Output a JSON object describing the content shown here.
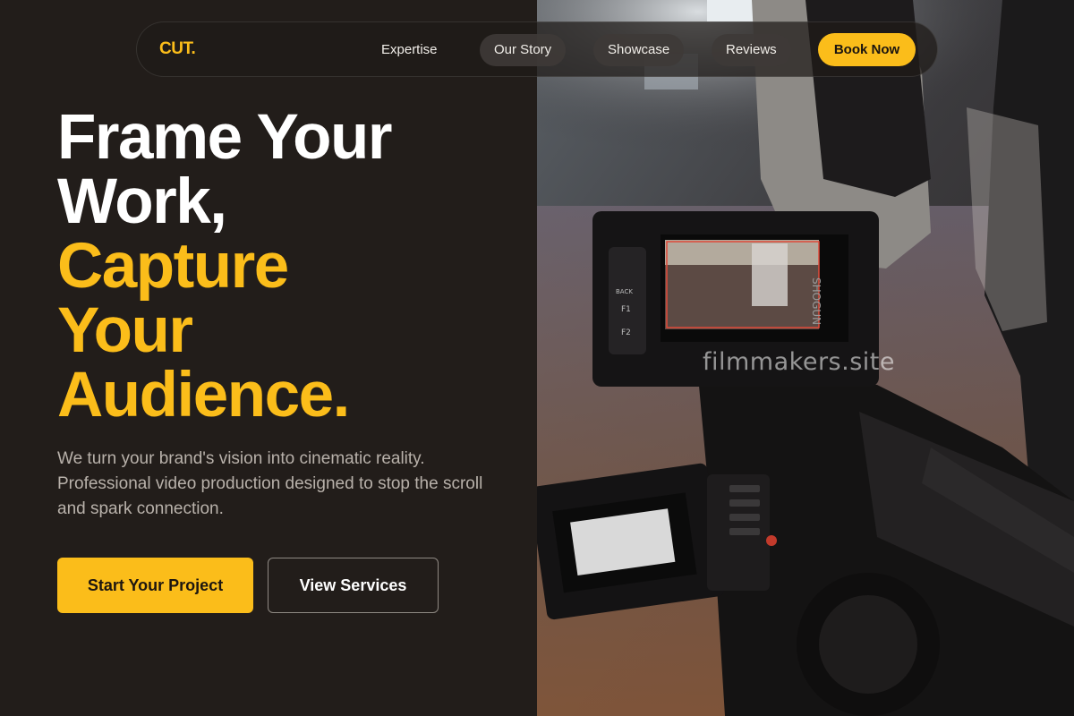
{
  "brand": {
    "logo": "CUT.",
    "accent_color": "#fbbd1a",
    "background_color": "#221d1a"
  },
  "nav": {
    "links": [
      {
        "label": "Expertise"
      },
      {
        "label": "Our Story"
      },
      {
        "label": "Showcase"
      },
      {
        "label": "Reviews"
      }
    ],
    "cta_label": "Book Now"
  },
  "hero": {
    "headline_lines_white": [
      "Frame Your",
      "Work,"
    ],
    "headline_lines_accent": [
      "Capture",
      "Your",
      "Audience."
    ],
    "subtext": "We turn your brand's vision into cinematic reality. Professional video production designed to stop the scroll and spark connection.",
    "primary_button": "Start Your Project",
    "secondary_button": "View Services"
  },
  "photo": {
    "description_icon": "cinema-camera-photo",
    "watermark": "filmmakers.site",
    "monitor_labels": {
      "back": "BACK",
      "f1": "F1",
      "f2": "F2",
      "brand": "SHOGUN"
    }
  }
}
